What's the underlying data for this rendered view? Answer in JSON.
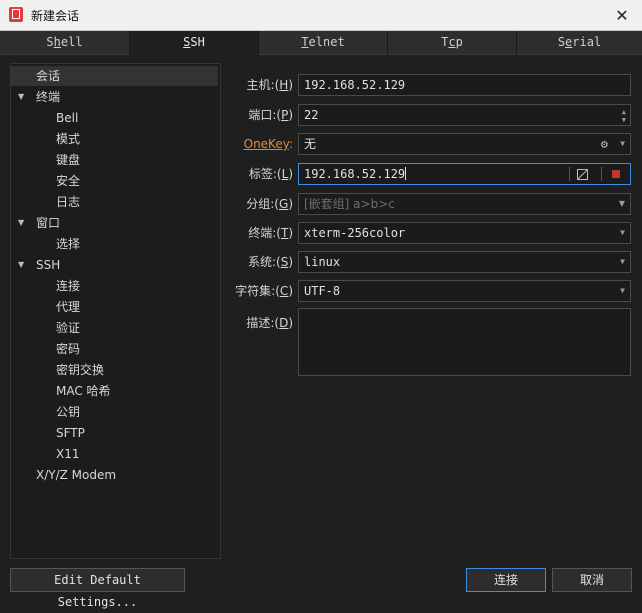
{
  "window": {
    "title": "新建会话",
    "close_glyph": "✕"
  },
  "tabs": [
    {
      "pre": "S",
      "ul": "h",
      "post": "ell",
      "active": false
    },
    {
      "pre": "",
      "ul": "S",
      "post": "SH",
      "active": true
    },
    {
      "pre": "",
      "ul": "T",
      "post": "elnet",
      "active": false
    },
    {
      "pre": "T",
      "ul": "c",
      "post": "p",
      "active": false
    },
    {
      "pre": "S",
      "ul": "e",
      "post": "rial",
      "active": false
    }
  ],
  "tree": {
    "items": [
      {
        "label": "会话",
        "level": 1,
        "selected": true
      },
      {
        "label": "终端",
        "level": 0,
        "expanded": true
      },
      {
        "label": "Bell",
        "level": 2
      },
      {
        "label": "模式",
        "level": 2
      },
      {
        "label": "键盘",
        "level": 2
      },
      {
        "label": "安全",
        "level": 2
      },
      {
        "label": "日志",
        "level": 2
      },
      {
        "label": "窗口",
        "level": 0,
        "expanded": true
      },
      {
        "label": "选择",
        "level": 2
      },
      {
        "label": "SSH",
        "level": 0,
        "expanded": true
      },
      {
        "label": "连接",
        "level": 2
      },
      {
        "label": "代理",
        "level": 2
      },
      {
        "label": "验证",
        "level": 2
      },
      {
        "label": "密码",
        "level": 2
      },
      {
        "label": "密钥交换",
        "level": 2
      },
      {
        "label": "MAC 哈希",
        "level": 2
      },
      {
        "label": "公钥",
        "level": 2
      },
      {
        "label": "SFTP",
        "level": 2
      },
      {
        "label": "X11",
        "level": 2
      },
      {
        "label": "X/Y/Z Modem",
        "level": 1
      }
    ]
  },
  "form": {
    "host": {
      "label": "主机",
      "key": "H",
      "value": "192.168.52.129"
    },
    "port": {
      "label": "端口",
      "key": "P",
      "value": "22"
    },
    "onekey": {
      "label": "OneKey",
      "value": "无",
      "icon": "gear-icon"
    },
    "tag": {
      "label": "标签",
      "key": "L",
      "value": "192.168.52.129"
    },
    "group": {
      "label": "分组",
      "key": "G",
      "placeholder": "[嵌套组] a>b>c"
    },
    "terminal": {
      "label": "终端",
      "key": "T",
      "value": "xterm-256color"
    },
    "system": {
      "label": "系统",
      "key": "S",
      "value": "linux"
    },
    "charset": {
      "label": "字符集",
      "key": "C",
      "value": "UTF-8"
    },
    "description": {
      "label": "描述",
      "key": "D",
      "value": ""
    }
  },
  "buttons": {
    "edit_defaults": "Edit Default Settings...",
    "connect": "连接",
    "cancel": "取消"
  },
  "colors": {
    "accent": "#3d8ee0",
    "onekey_label": "#e08a3c",
    "record_icon": "#c0392b"
  }
}
